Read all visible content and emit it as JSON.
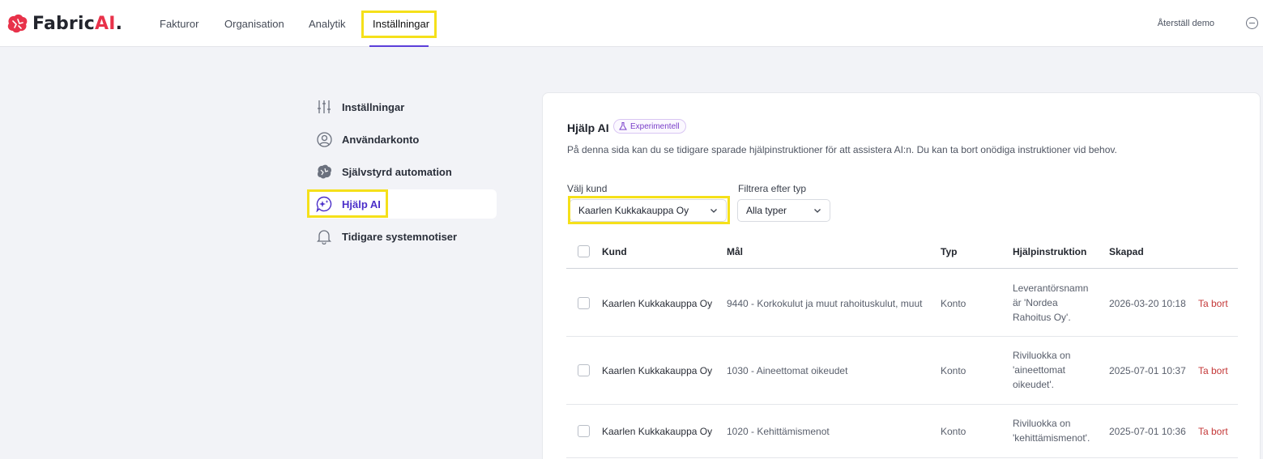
{
  "brand": {
    "name_main": "Fabric",
    "name_accent": "AI",
    "name_dot": "."
  },
  "nav": {
    "items": [
      {
        "label": "Fakturor"
      },
      {
        "label": "Organisation"
      },
      {
        "label": "Analytik"
      },
      {
        "label": "Inställningar",
        "active": true
      }
    ],
    "reset_demo": "Återställ demo"
  },
  "sidebar": {
    "items": [
      {
        "label": "Inställningar",
        "icon": "sliders-icon"
      },
      {
        "label": "Användarkonto",
        "icon": "user-circle-icon"
      },
      {
        "label": "Självstyrd automation",
        "icon": "brain-icon"
      },
      {
        "label": "Hjälp AI",
        "icon": "ai-chat-icon",
        "active": true
      },
      {
        "label": "Tidigare systemnotiser",
        "icon": "bell-icon"
      }
    ]
  },
  "card": {
    "title": "Hjälp AI",
    "badge": "Experimentell",
    "description": "På denna sida kan du se tidigare sparade hjälpinstruktioner för att assistera AI:n. Du kan ta bort onödiga instruktioner vid behov.",
    "customer_filter": {
      "label": "Välj kund",
      "value": "Kaarlen Kukkakauppa Oy"
    },
    "type_filter": {
      "label": "Filtrera efter typ",
      "value": "Alla typer"
    }
  },
  "table": {
    "headers": {
      "customer": "Kund",
      "target": "Mål",
      "type": "Typ",
      "instruction": "Hjälpinstruktion",
      "created": "Skapad"
    },
    "rows": [
      {
        "customer": "Kaarlen Kukkakauppa Oy",
        "target": "9440 - Korkokulut ja muut rahoituskulut, muut",
        "type": "Konto",
        "instruction": "Leverantörsnamn är 'Nordea Rahoitus Oy'.",
        "created": "2026-03-20 10:18",
        "action": "Ta bort"
      },
      {
        "customer": "Kaarlen Kukkakauppa Oy",
        "target": "1030 - Aineettomat oikeudet",
        "type": "Konto",
        "instruction": "Riviluokka on 'aineettomat oikeudet'.",
        "created": "2025-07-01 10:37",
        "action": "Ta bort"
      },
      {
        "customer": "Kaarlen Kukkakauppa Oy",
        "target": "1020 - Kehittämismenot",
        "type": "Konto",
        "instruction": "Riviluokka on 'kehittämismenot'.",
        "created": "2025-07-01 10:36",
        "action": "Ta bort"
      }
    ]
  },
  "colors": {
    "accent": "#5b3fd9",
    "brand_red": "#e8324a",
    "delete": "#c43838",
    "highlight": "#f5e01a"
  }
}
